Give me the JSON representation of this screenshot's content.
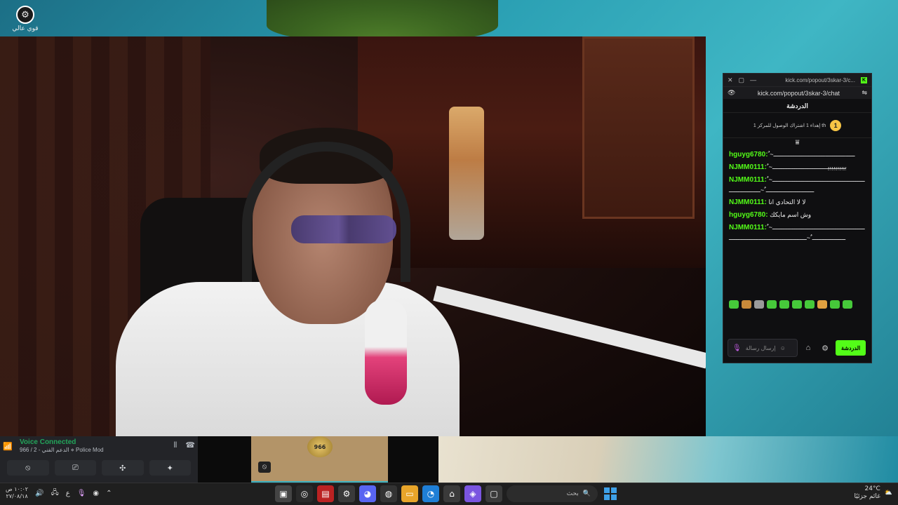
{
  "desktop": {
    "icon_label": "قوي عالي"
  },
  "voice_panel": {
    "title": "Voice Connected",
    "subtitle": "الدعم الفني - 2 / 966 ⋄ Police Mod",
    "buttons": [
      "⦸",
      "⎚",
      "✣",
      "✦"
    ]
  },
  "overlay": {
    "badge_text": "966"
  },
  "chat": {
    "window_title": "kick.com/popout/3skar-3/c...",
    "url": "kick.com/popout/3skar-3/chat",
    "header": "الدردشة",
    "pinned": {
      "count": "1",
      "text": "إهداء 1 اشتراك الوصول للمركز 1 th"
    },
    "messages": [
      {
        "user": "hguyg6780:",
        "text": "ٌ~ــــــــــــــــــــــــــــــــــــــــــــ"
      },
      {
        "user": "NJMM0111:",
        "text": "ٌ~بيبيبيبيبيــــــــــــــــــــــــــــــ"
      },
      {
        "user": "NJMM0111:",
        "text": "ٌ~ــــــــــــــــــــــــــــــــــــــــــــــــــــــــــــــــــــــــــــ ٌ~ـــــــــــــــــ"
      },
      {
        "user": "NJMM0111:",
        "text": "لا لا التحادي انا"
      },
      {
        "user": "hguyg6780:",
        "text": "وش اسم مايكك"
      },
      {
        "user": "NJMM0111:",
        "text": "ٌ~ــــــــــــــــــــــــــــــــــــــــــــــــــــــــــــــــــــ ٌ~ــــــــــــــــــــــــــــــــــــــــــ"
      }
    ],
    "input_placeholder": "إرسال رسالة",
    "send_label": "الدردشة"
  },
  "taskbar": {
    "clock_time": "١٠:٠٢ ص",
    "clock_date": "٢٧/٠٨/١٨",
    "lang": "ع",
    "search_label": "بحث",
    "weather_temp": "24°C",
    "weather_desc": "غائم جزئيًا"
  },
  "colors": {
    "kick_green": "#53fc18",
    "discord_green": "#23a55a",
    "taskbar": "#1f1f1f"
  }
}
